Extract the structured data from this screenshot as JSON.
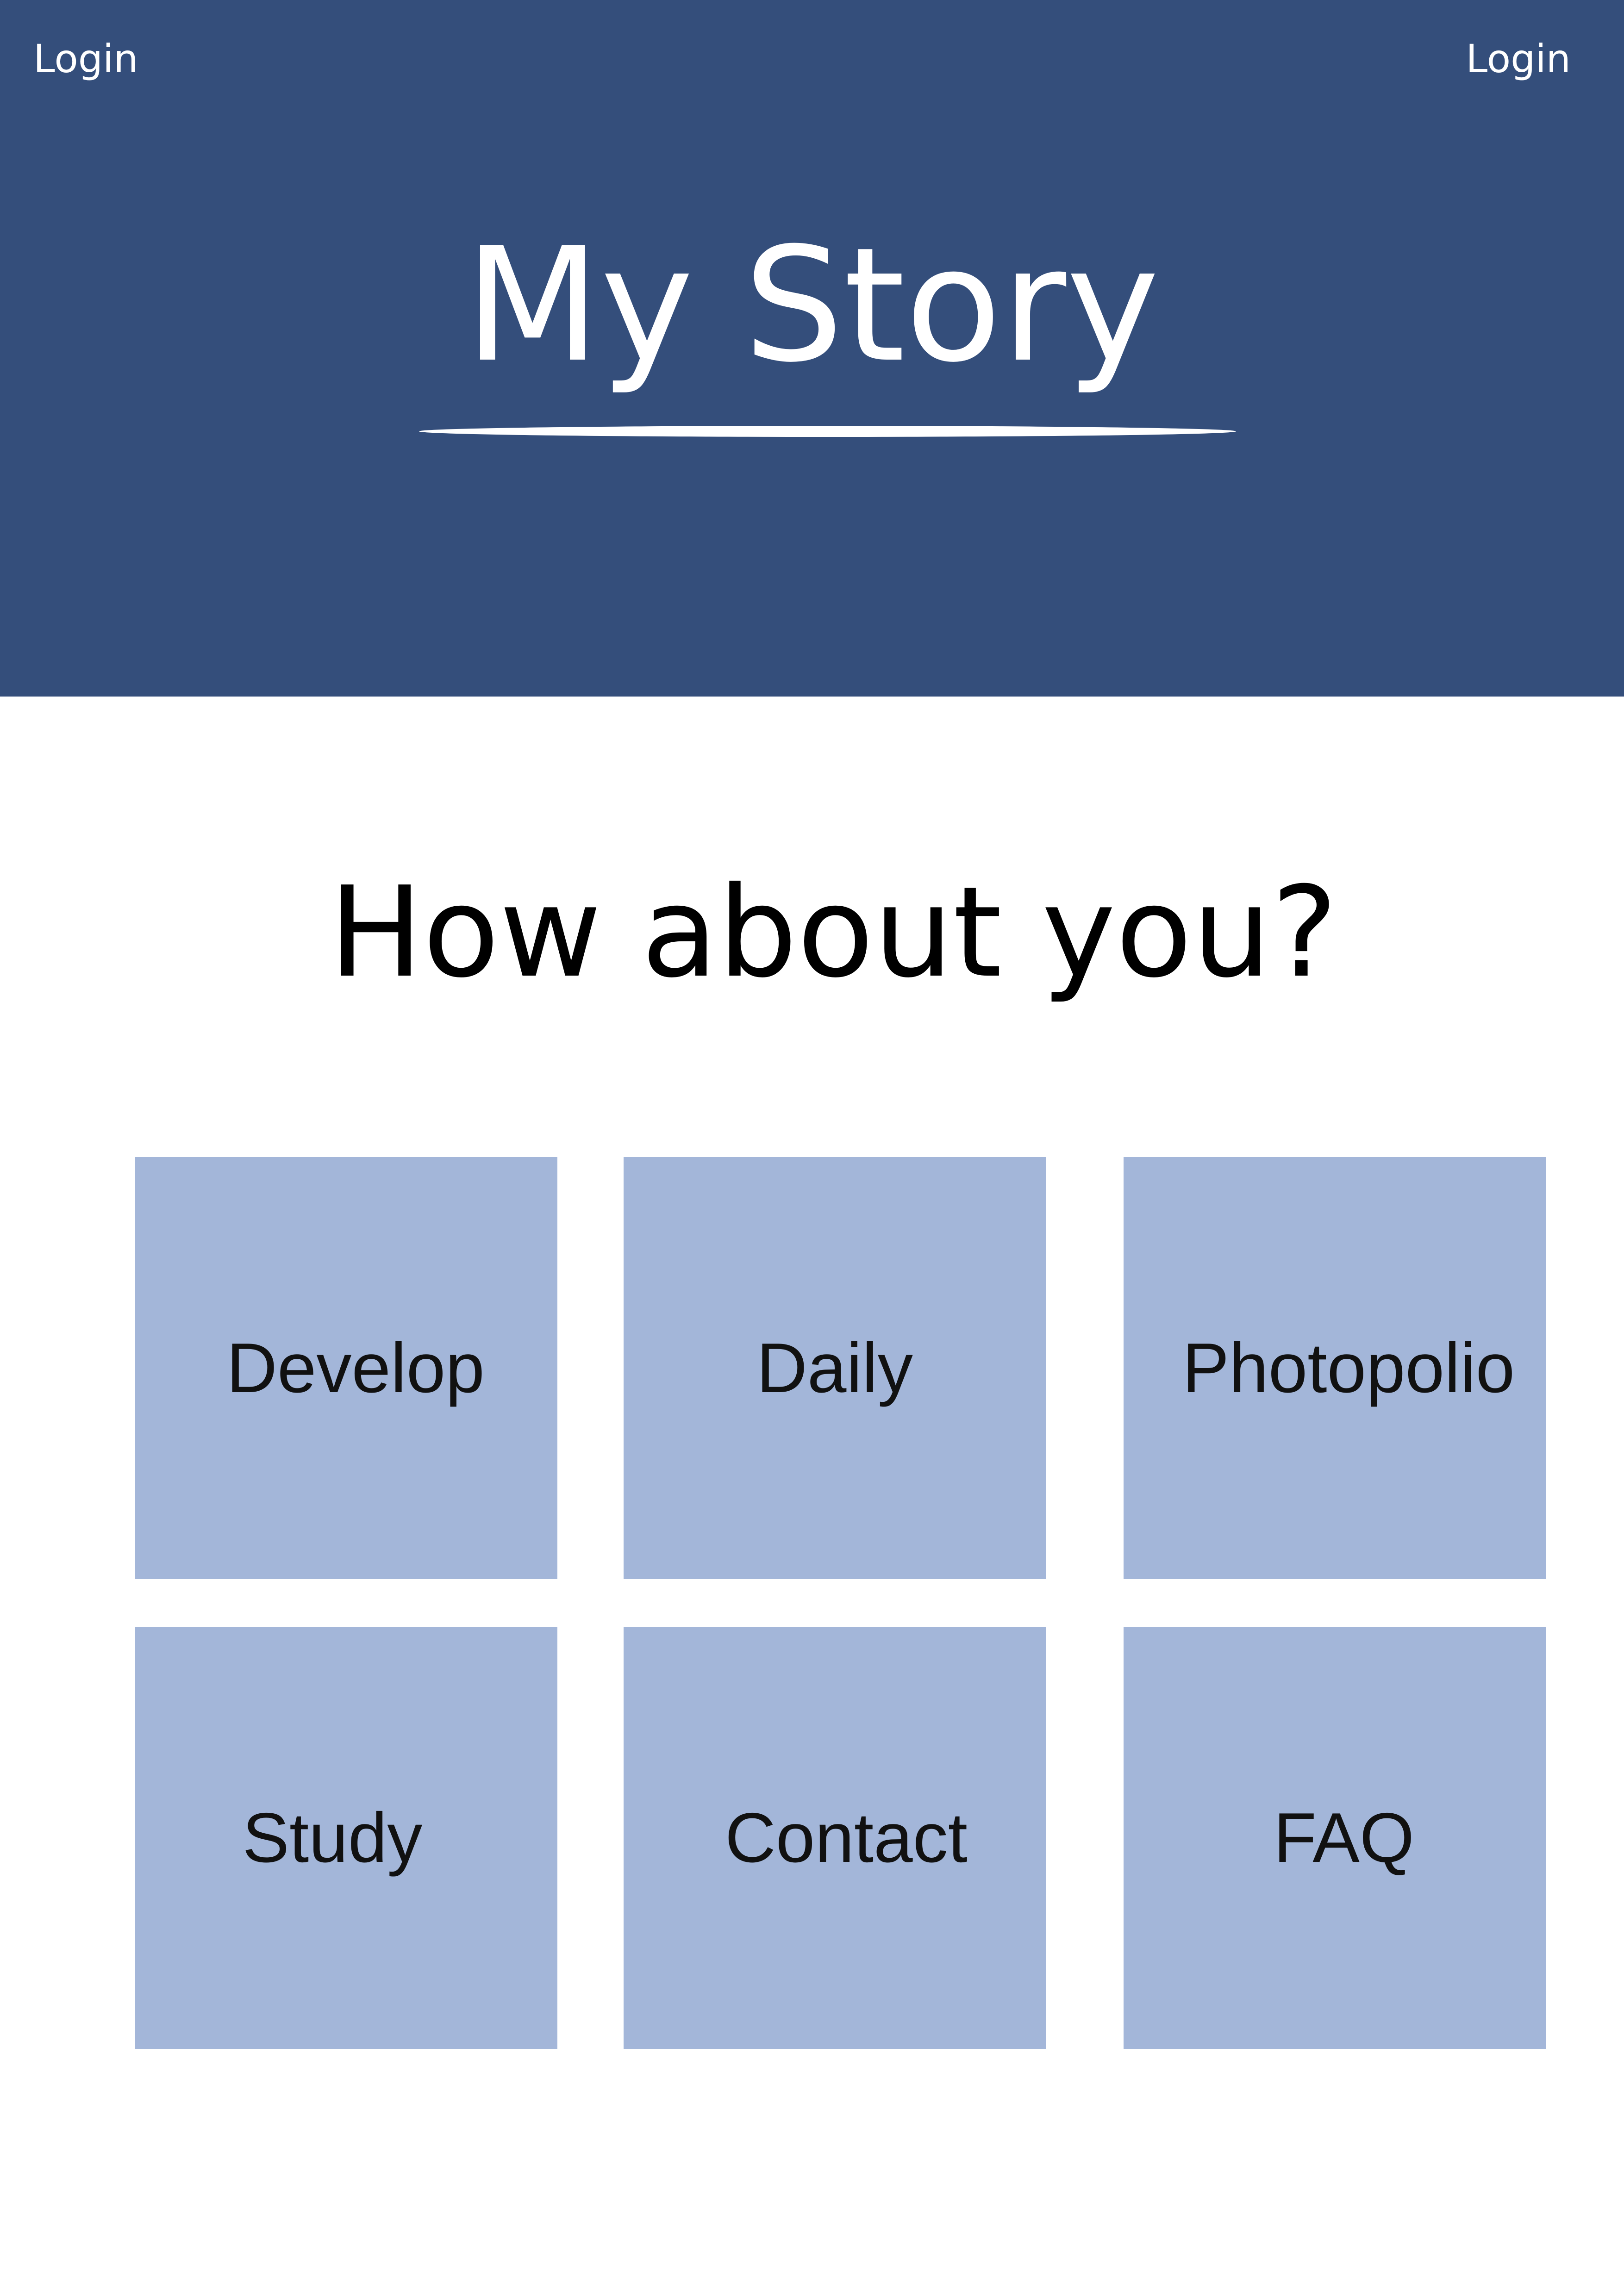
{
  "header": {
    "login_left": "Login",
    "login_right": "Login",
    "title": "My Story",
    "background_color": "#344e7b"
  },
  "main": {
    "heading": "How about you?",
    "tile_color": "#a3b6d9",
    "tiles": [
      {
        "label": "Develop"
      },
      {
        "label": "Daily"
      },
      {
        "label": "Photopolio"
      },
      {
        "label": "Study"
      },
      {
        "label": "Contact"
      },
      {
        "label": "FAQ"
      }
    ]
  }
}
